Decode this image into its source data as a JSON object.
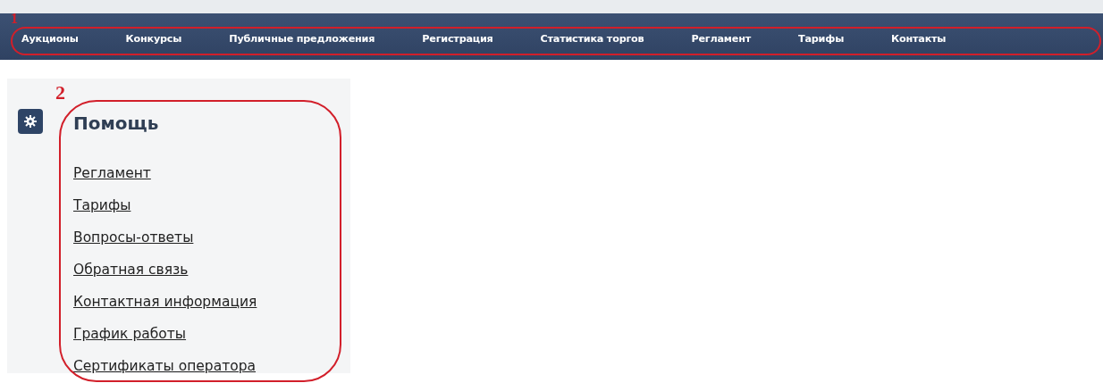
{
  "nav": {
    "annotation": "1",
    "items": [
      "Аукционы",
      "Конкурсы",
      "Публичные предложения",
      "Регистрация",
      "Статистика торгов",
      "Регламент",
      "Тарифы",
      "Контакты"
    ]
  },
  "help_panel": {
    "annotation": "2",
    "title": "Помощь",
    "links": [
      "Регламент",
      "Тарифы",
      "Вопросы-ответы",
      "Обратная связь",
      "Контактная информация",
      "График работы",
      "Сертификаты оператора"
    ]
  }
}
